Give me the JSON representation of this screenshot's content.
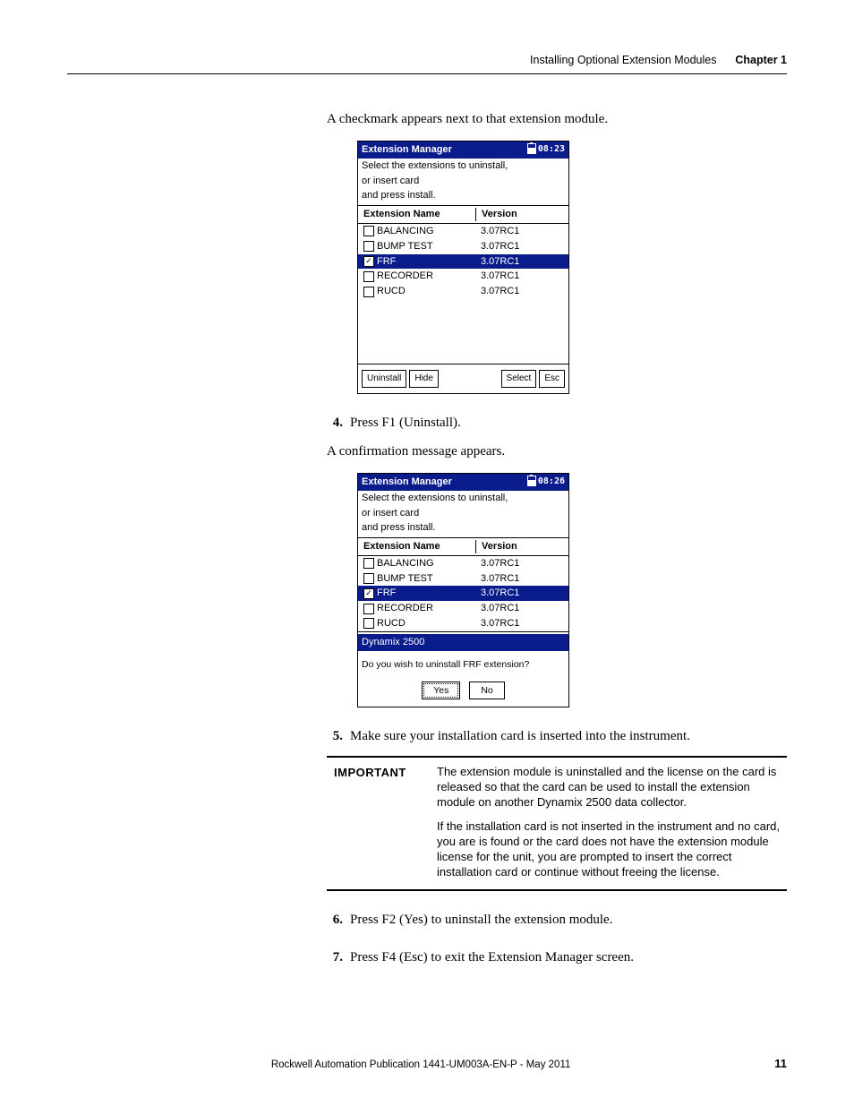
{
  "header": {
    "section": "Installing Optional Extension Modules",
    "chapter": "Chapter 1"
  },
  "intro": "A checkmark appears next to that extension module.",
  "device1": {
    "title": "Extension Manager",
    "time": "08:23",
    "msg1": "Select the extensions to uninstall,",
    "msg2": "or insert card",
    "msg3": "and press install.",
    "col1": "Extension Name",
    "col2": "Version",
    "rows": [
      {
        "name": "BALANCING",
        "ver": "3.07RC1",
        "checked": false,
        "sel": false
      },
      {
        "name": "BUMP TEST",
        "ver": "3.07RC1",
        "checked": false,
        "sel": false
      },
      {
        "name": "FRF",
        "ver": "3.07RC1",
        "checked": true,
        "sel": true
      },
      {
        "name": "RECORDER",
        "ver": "3.07RC1",
        "checked": false,
        "sel": false
      },
      {
        "name": "RUCD",
        "ver": "3.07RC1",
        "checked": false,
        "sel": false
      }
    ],
    "btn1": "Uninstall",
    "btn2": "Hide",
    "btn3": "Select",
    "btn4": "Esc"
  },
  "step4num": "4.",
  "step4": "Press F1 (Uninstall).",
  "step4after": "A confirmation message appears.",
  "device2": {
    "title": "Extension Manager",
    "time": "08:26",
    "msg1": "Select the extensions to uninstall,",
    "msg2": "or insert card",
    "msg3": "and press install.",
    "col1": "Extension Name",
    "col2": "Version",
    "rows": [
      {
        "name": "BALANCING",
        "ver": "3.07RC1",
        "checked": false,
        "sel": false
      },
      {
        "name": "BUMP TEST",
        "ver": "3.07RC1",
        "checked": false,
        "sel": false
      },
      {
        "name": "FRF",
        "ver": "3.07RC1",
        "checked": true,
        "sel": true
      },
      {
        "name": "RECORDER",
        "ver": "3.07RC1",
        "checked": false,
        "sel": false
      },
      {
        "name": "RUCD",
        "ver": "3.07RC1",
        "checked": false,
        "sel": false
      }
    ],
    "dlgTitle": "Dynamix 2500",
    "dlgMsg": "Do you wish to uninstall FRF extension?",
    "dlgYes": "Yes",
    "dlgNo": "No"
  },
  "step5num": "5.",
  "step5": "Make sure your installation card is inserted into the instrument.",
  "important": {
    "label": "IMPORTANT",
    "p1": "The extension module is uninstalled and the license on the card is released so that the card can be used to install the extension module on another Dynamix 2500 data collector.",
    "p2": "If the installation card is not inserted in the instrument and no card, you are is found or the card does not have the extension module license for the unit, you are prompted to insert the correct installation card or continue without freeing the license."
  },
  "step6num": "6.",
  "step6": "Press F2 (Yes) to uninstall the extension module.",
  "step7num": "7.",
  "step7": "Press F4 (Esc) to exit the Extension Manager screen.",
  "footer": {
    "pub": "Rockwell Automation Publication 1441-UM003A-EN-P - May 2011",
    "page": "11"
  }
}
